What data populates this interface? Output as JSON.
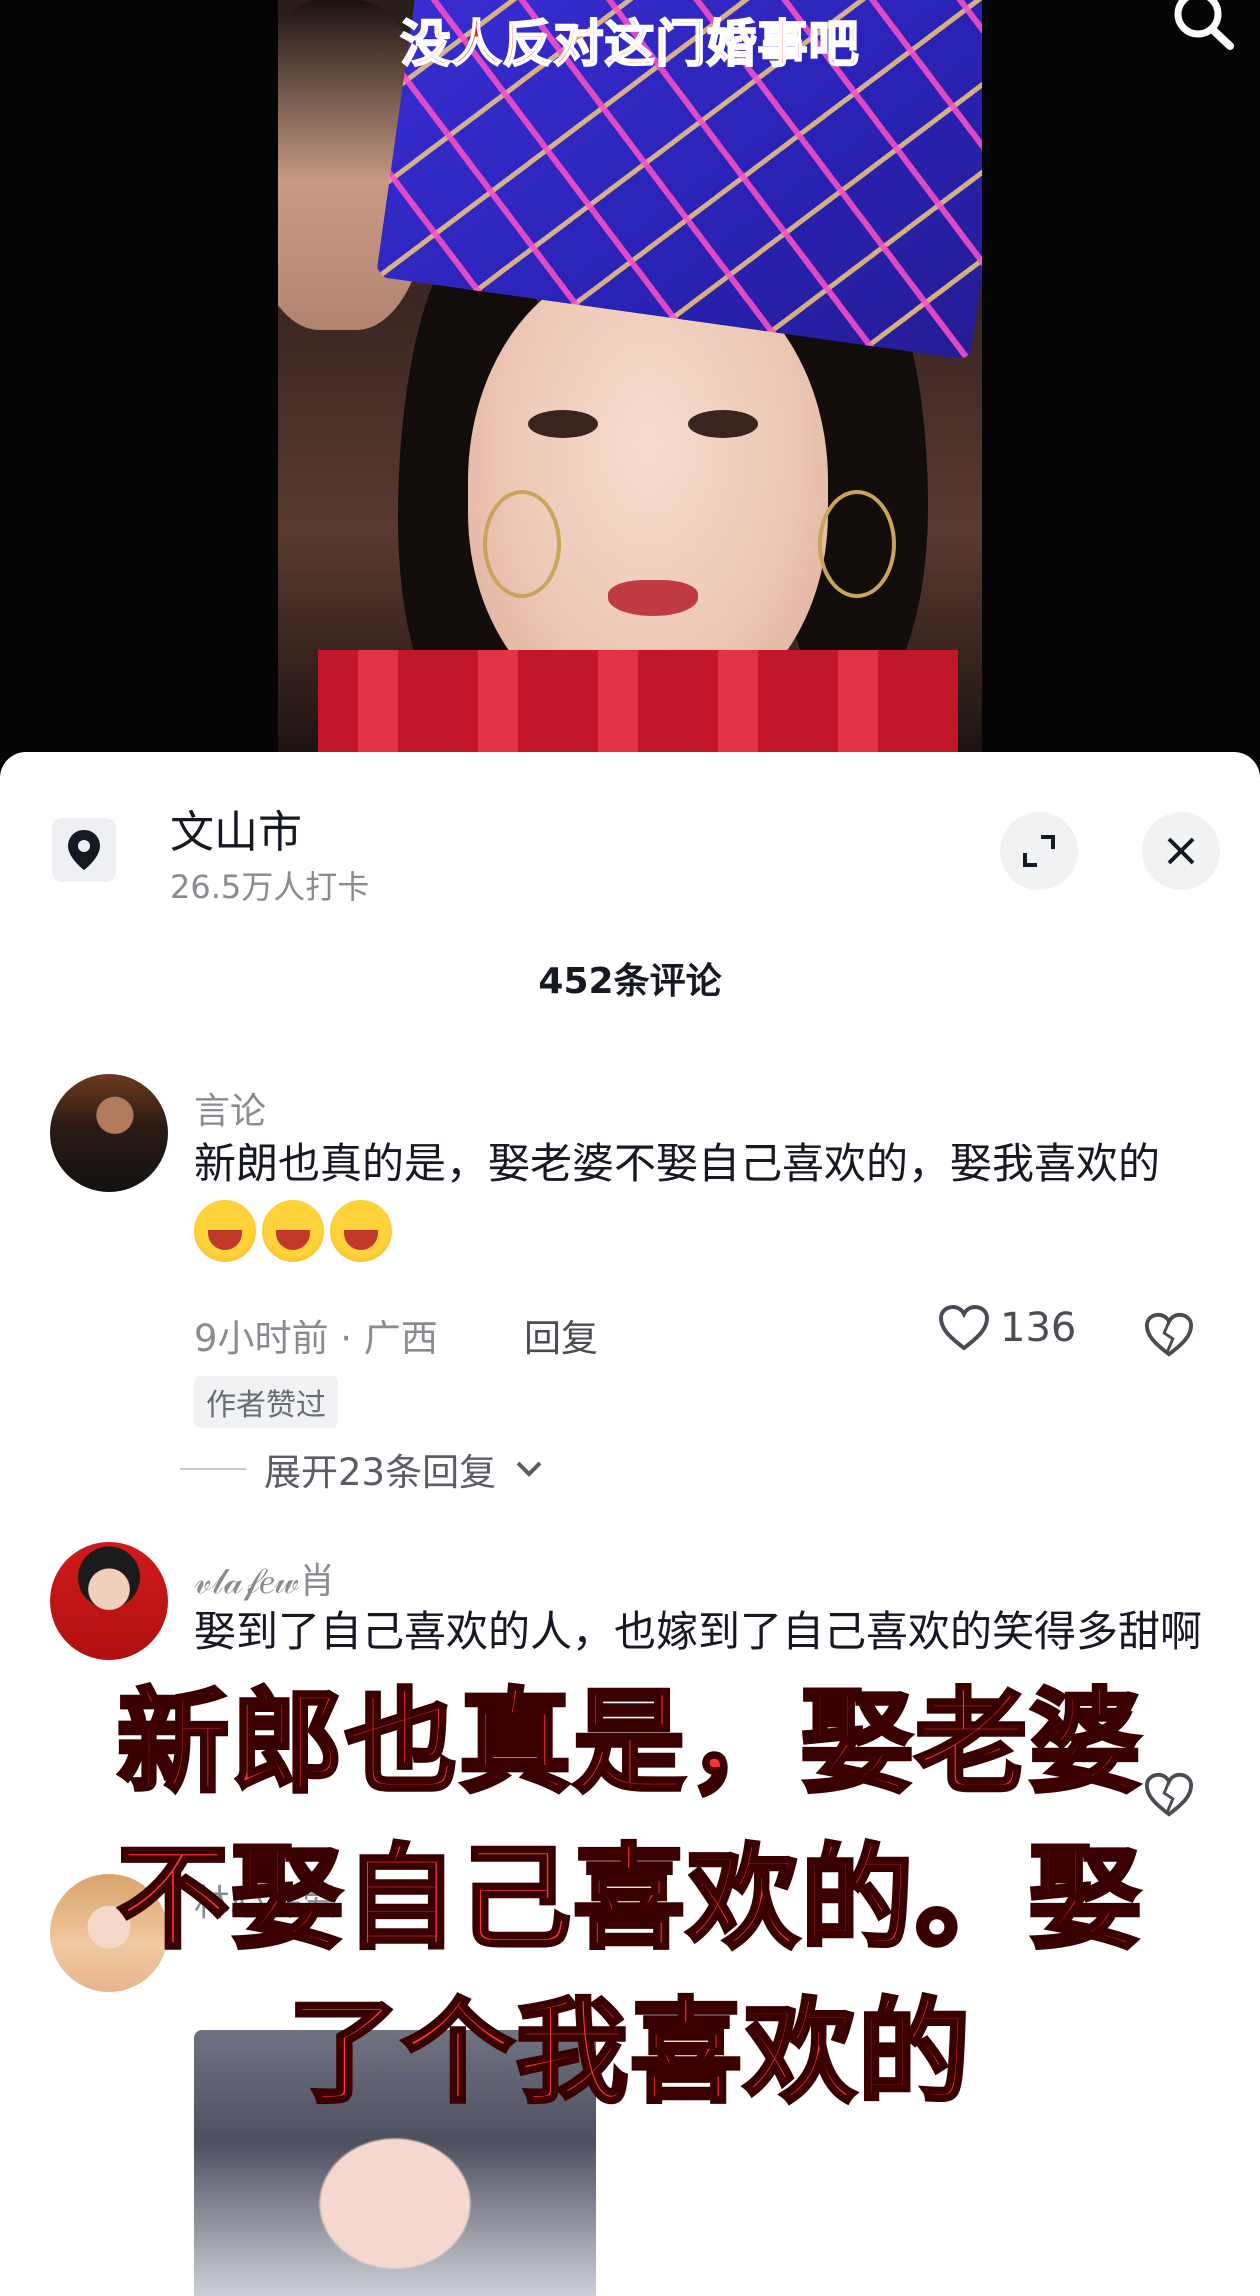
{
  "video": {
    "title": "没人反对这门婚事吧",
    "icons": {
      "search": "search-icon"
    }
  },
  "location": {
    "name": "文山市",
    "subtitle": "26.5万人打卡",
    "icon": "location-pin-icon"
  },
  "comments_header": {
    "count_label": "452条评论"
  },
  "comments": [
    {
      "user": "言论",
      "text": "新朗也真的是，娶老婆不娶自己喜欢的，娶我喜欢的",
      "emoji_count": 3,
      "time_location": "9小时前 · 广西",
      "reply_label": "回复",
      "likes": "136",
      "badge": "作者赞过",
      "expand_label": "展开23条回复"
    },
    {
      "user": "𝓋𝓁𝒶𝒻𝑒𝓌肖",
      "text": "娶到了自己喜欢的人，也嫁到了自己喜欢的笑得多甜啊"
    },
    {
      "user": "林心銇爱"
    }
  ],
  "overlay_caption": {
    "line1": "新郎也真是，娶老婆",
    "line2": "不娶自己喜欢的。娶",
    "line3": "了个我喜欢的"
  },
  "colors": {
    "overlay_red": "#ff3333",
    "title_red": "#e4262b"
  }
}
